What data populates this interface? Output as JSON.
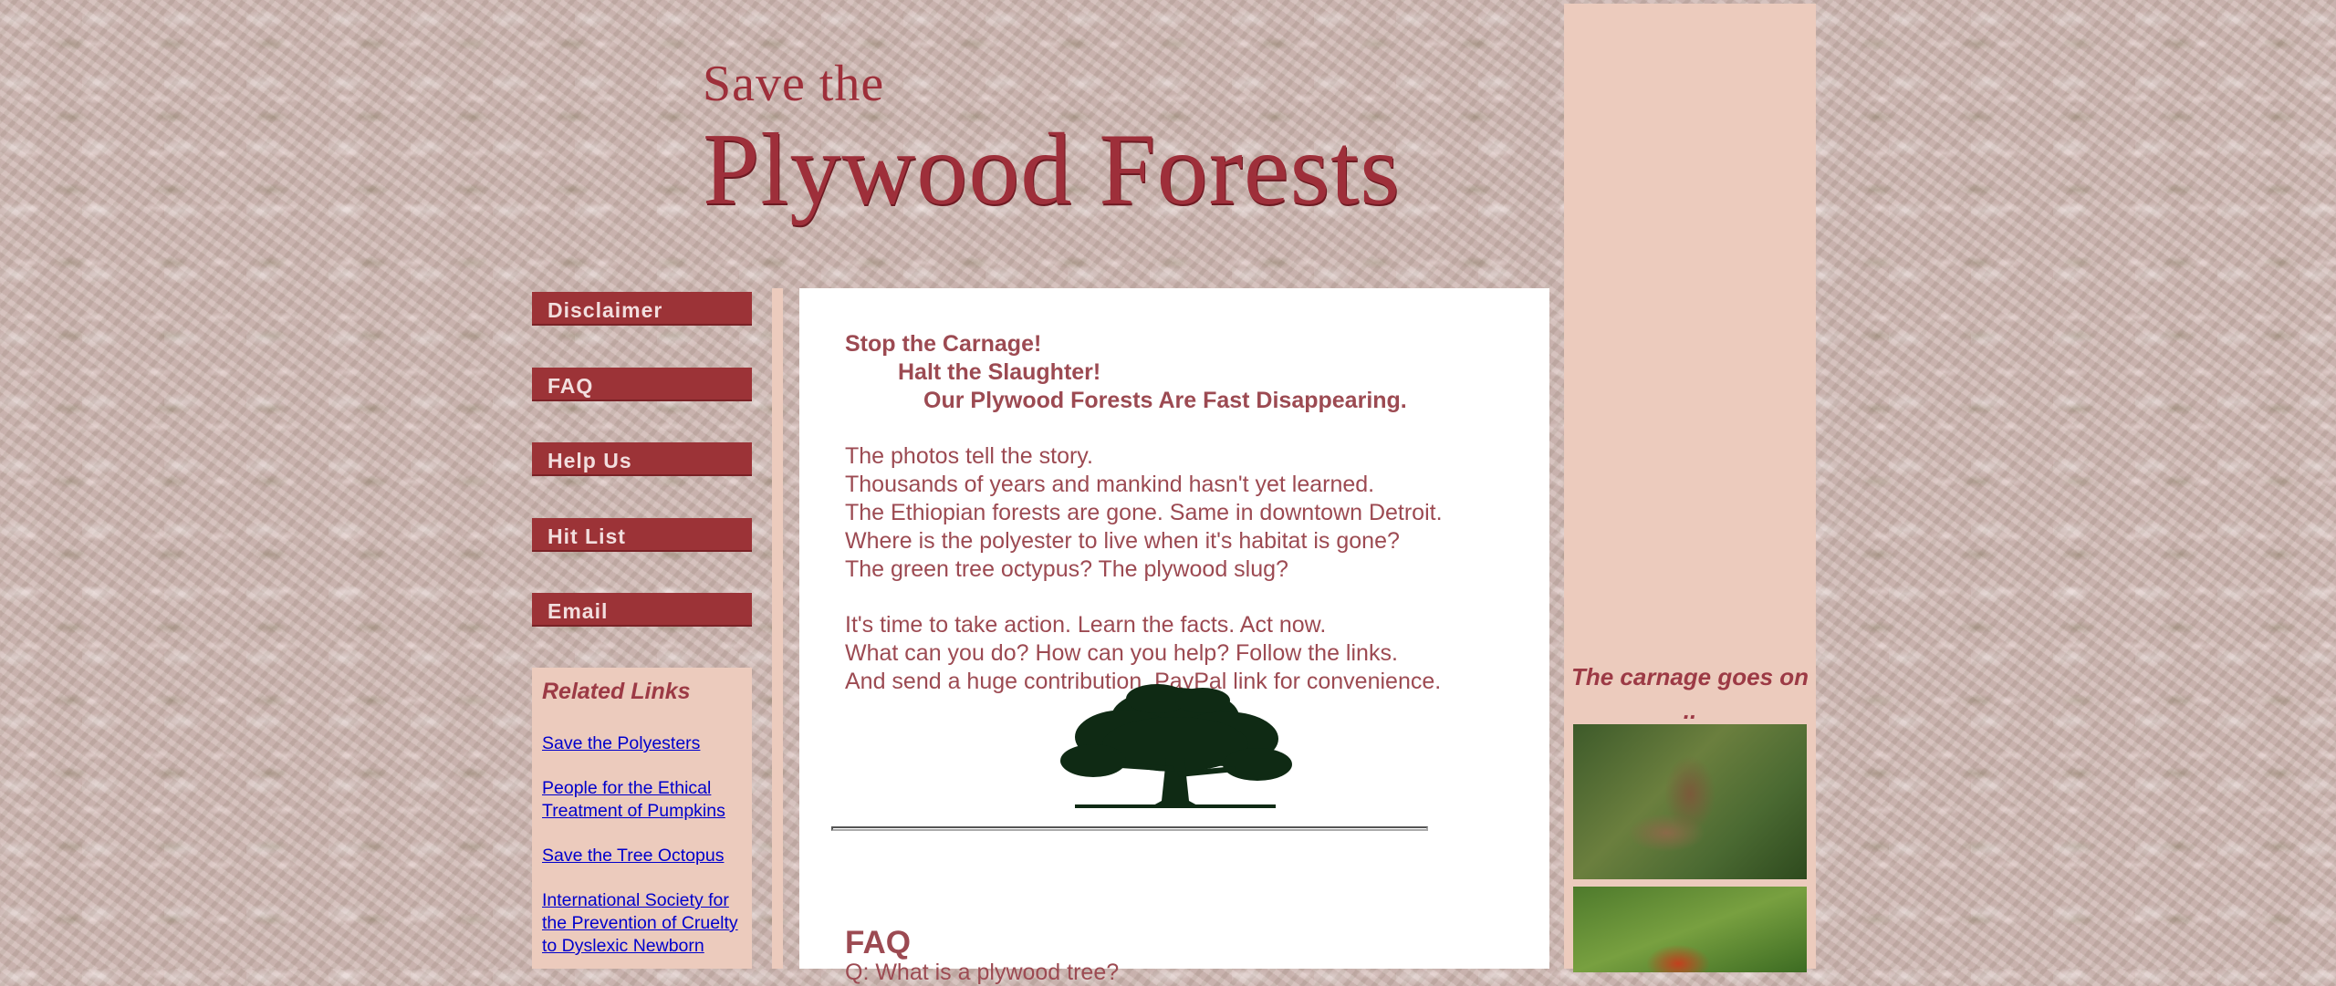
{
  "header": {
    "logo_line1": "Save the",
    "logo_line2": "Plywood Forests"
  },
  "nav": {
    "items": [
      {
        "label": "Disclaimer"
      },
      {
        "label": "FAQ"
      },
      {
        "label": "Help Us"
      },
      {
        "label": "Hit List"
      },
      {
        "label": "Email"
      }
    ]
  },
  "related": {
    "title": "Related Links",
    "links": [
      "Save the Polyesters",
      "People for the Ethical Treatment of Pumpkins",
      "Save the Tree Octopus",
      "International Society for the Prevention of Cruelty to Dyslexic Newborn"
    ]
  },
  "main": {
    "heading": [
      "Stop the Carnage!",
      "Halt the Slaughter!",
      "Our Plywood Forests Are Fast Disappearing."
    ],
    "para1": [
      "The photos tell the story.",
      "Thousands of years and mankind hasn't yet learned.",
      "The Ethiopian forests are gone. Same in downtown Detroit.",
      "Where is the polyester to live when it's habitat is gone?",
      "The green tree octypus? The plywood slug?"
    ],
    "para2": [
      "It's time to take action. Learn the facts. Act now.",
      "What can you do? How can you help? Follow the links.",
      "And send a huge contribution. PayPal link for convenience."
    ],
    "faq_title": "FAQ",
    "faq_first_question": "Q: What is a plywood tree?"
  },
  "sidebar_right": {
    "caption": "The carnage goes on .."
  },
  "colors": {
    "nav_button": "#9c3337",
    "panel_pink": "#eccbbd",
    "text_maroon": "#9c4a52",
    "link": "#0000cc"
  }
}
